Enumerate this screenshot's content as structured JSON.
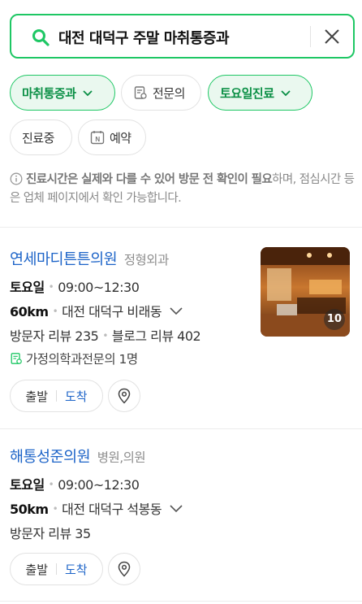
{
  "search": {
    "query": "대전 대덕구 주말 마취통증과"
  },
  "filters": [
    {
      "label": "마취통증과",
      "active": true,
      "icon": "chevron-down-icon"
    },
    {
      "label": "전문의",
      "active": false,
      "icon": "doctor-badge-icon"
    },
    {
      "label": "토요일진료",
      "active": true,
      "icon": "chevron-down-icon"
    },
    {
      "label": "진료중",
      "active": false
    },
    {
      "label": "예약",
      "active": false,
      "icon": "naver-booking-icon"
    }
  ],
  "notice": {
    "bold": "진료시간은 실제와 다를 수 있어 방문 전 확인이 필요",
    "rest": "하며, 점심시간 등은 업체 페이지에서 확인 가능합니다."
  },
  "places": [
    {
      "name": "연세마디튼튼의원",
      "category": "정형외과",
      "day": "토요일",
      "hours": "09:00~12:30",
      "distance": "60km",
      "address": "대전 대덕구 비래동",
      "visitor_review": "방문자 리뷰 235",
      "blog_review": "블로그 리뷰 402",
      "specialist": "가정의학과전문의 1명",
      "photo_count": "10",
      "route_start": "출발",
      "route_arrive": "도착"
    },
    {
      "name": "해통성준의원",
      "category": "병원,의원",
      "day": "토요일",
      "hours": "09:00~12:30",
      "distance": "50km",
      "address": "대전 대덕구 석봉동",
      "visitor_review": "방문자 리뷰 35",
      "route_start": "출발",
      "route_arrive": "도착"
    }
  ],
  "colors": {
    "accent": "#1ec764",
    "link": "#1d64c8"
  }
}
